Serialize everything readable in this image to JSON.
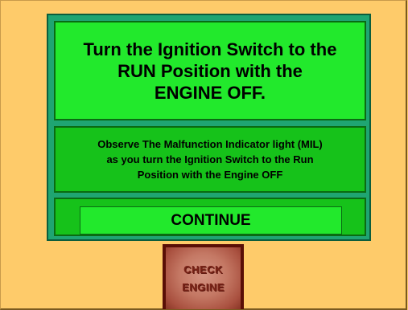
{
  "instruction": {
    "title": "Turn the Ignition Switch to the\nRUN Position with the\nENGINE OFF.",
    "observe_text": "Observe The Malfunction Indicator light (MIL)\nas you turn the Ignition Switch to the Run\nPosition with the Engine OFF"
  },
  "continue_button": {
    "label": "CONTINUE"
  },
  "mil_light": {
    "line1": "CHECK",
    "line2": "ENGINE"
  },
  "colors": {
    "background": "#fecb6a",
    "panel": "#1fa572",
    "box_bright": "#22e92c",
    "box_mid": "#16c21a",
    "mil_dark": "#5a0f06"
  }
}
